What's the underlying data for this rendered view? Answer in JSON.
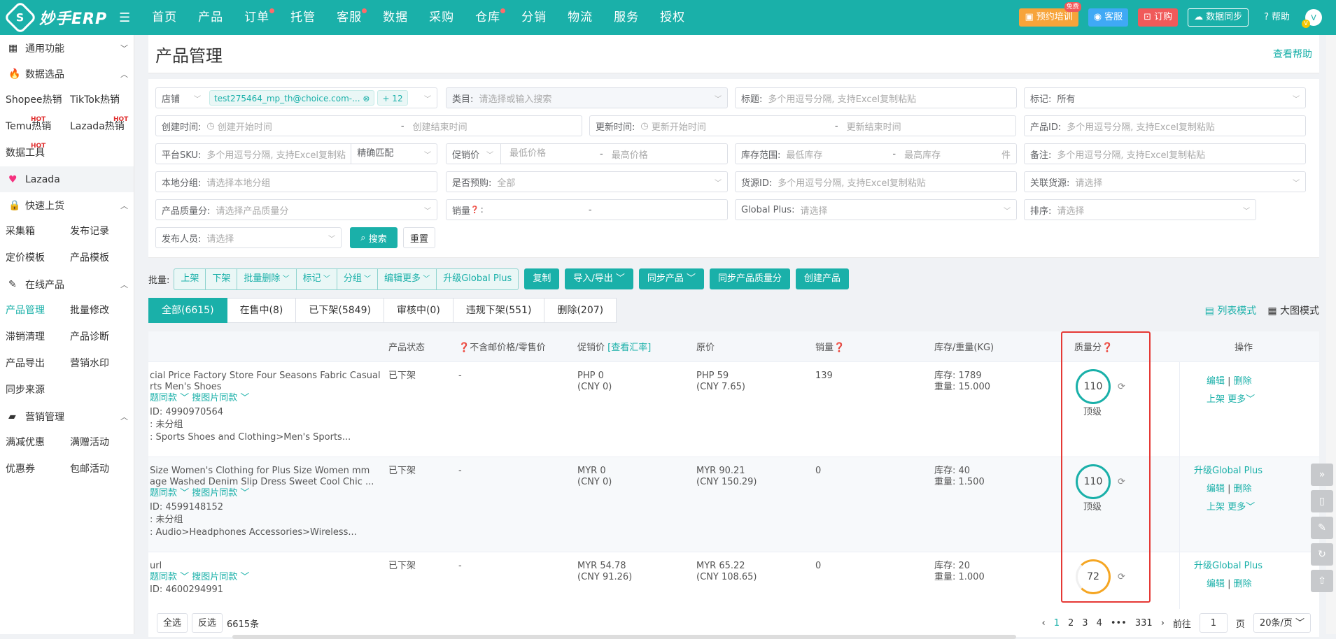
{
  "brand": {
    "logo_char": "S",
    "name": "妙手ERP"
  },
  "nav": [
    {
      "label": "首页",
      "dot": false
    },
    {
      "label": "产品",
      "dot": false
    },
    {
      "label": "订单",
      "dot": true
    },
    {
      "label": "托管",
      "dot": false
    },
    {
      "label": "客服",
      "dot": true
    },
    {
      "label": "数据",
      "dot": false
    },
    {
      "label": "采购",
      "dot": false
    },
    {
      "label": "仓库",
      "dot": true
    },
    {
      "label": "分销",
      "dot": false
    },
    {
      "label": "物流",
      "dot": false
    },
    {
      "label": "服务",
      "dot": false
    },
    {
      "label": "授权",
      "dot": false
    }
  ],
  "topright": {
    "training": "预约培训",
    "training_badge": "免费",
    "service": "客服",
    "order": "订购",
    "sync": "数据同步",
    "help": "帮助",
    "avatar": "V"
  },
  "sidebar": {
    "common": "通用功能",
    "data_select": "数据选品",
    "data_items": [
      "Shopee热销",
      "TikTok热销",
      "Temu热销",
      "Lazada热销",
      "数据工具"
    ],
    "hot": "HOT",
    "lazada": "Lazada",
    "quick_upload": "快速上货",
    "quick_items": [
      "采集箱",
      "发布记录",
      "定价模板",
      "产品模板"
    ],
    "online": "在线产品",
    "online_items": [
      "产品管理",
      "批量修改",
      "滞销清理",
      "产品诊断",
      "产品导出",
      "营销水印",
      "同步来源"
    ],
    "marketing": "营销管理",
    "marketing_items": [
      "满减优惠",
      "满赠活动",
      "优惠券",
      "包邮活动"
    ]
  },
  "page": {
    "title": "产品管理",
    "help": "查看帮助"
  },
  "filters": {
    "shop_label": "店铺",
    "shop_tag": "test275464_mp_th@choice.com-...",
    "shop_more": "+ 12",
    "category_label": "类目:",
    "category_ph": "请选择或输入搜索",
    "title_label": "标题:",
    "title_ph": "多个用逗号分隔, 支持Excel复制粘贴",
    "mark_label": "标记:",
    "mark_value": "所有",
    "created_label": "创建时间:",
    "created_start": "创建开始时间",
    "created_end": "创建结束时间",
    "updated_label": "更新时间:",
    "updated_start": "更新开始时间",
    "updated_end": "更新结束时间",
    "pid_label": "产品ID:",
    "pid_ph": "多个用逗号分隔, 支持Excel复制粘贴",
    "sku_label": "平台SKU:",
    "sku_ph": "多个用逗号分隔, 支持Excel复制粘",
    "sku_match": "精确匹配",
    "promo_label": "促销价",
    "price_min": "最低价格",
    "price_max": "最高价格",
    "stock_label": "库存范围:",
    "stock_min": "最低库存",
    "stock_max": "最高库存",
    "stock_unit": "件",
    "note_label": "备注:",
    "note_ph": "多个用逗号分隔, 支持Excel复制粘贴",
    "group_label": "本地分组:",
    "group_ph": "请选择本地分组",
    "preorder_label": "是否预购:",
    "preorder_value": "全部",
    "source_label": "货源ID:",
    "source_ph": "多个用逗号分隔, 支持Excel复制粘贴",
    "linked_label": "关联货源:",
    "linked_ph": "请选择",
    "quality_label": "产品质量分:",
    "quality_ph": "请选择产品质量分",
    "sales_label": "销量",
    "sales_sep": "-",
    "gplus_label": "Global Plus:",
    "gplus_ph": "请选择",
    "sort_label": "排序:",
    "sort_ph": "请选择",
    "publisher_label": "发布人员:",
    "publisher_ph": "请选择",
    "search": "搜索",
    "reset": "重置",
    "dash": "-"
  },
  "batch": {
    "label": "批量:",
    "group": [
      "上架",
      "下架",
      "批量删除",
      "标记",
      "分组",
      "编辑更多",
      "升级Global Plus"
    ],
    "buttons": [
      "复制",
      "导入/导出",
      "同步产品",
      "同步产品质量分",
      "创建产品"
    ]
  },
  "tabs": [
    "全部(6615)",
    "在售中(8)",
    "已下架(5849)",
    "审核中(0)",
    "违规下架(551)",
    "删除(207)"
  ],
  "view_modes": {
    "list": "列表模式",
    "grid": "大图模式"
  },
  "table": {
    "headers": {
      "status": "产品状态",
      "price": "不含邮价格/零售价",
      "promo": "促销价",
      "rate": "[查看汇率]",
      "orig": "原价",
      "sales": "销量",
      "stock": "库存/重量(KG)",
      "quality": "质量分",
      "ops": "操作"
    },
    "rows": [
      {
        "title1": "cial Price Factory Store Four Seasons Fabric Casual",
        "title2": "rts Men's Shoes",
        "same_title": "题同款",
        "same_img": "搜图片同款",
        "id": "ID: 4990970564",
        "group": ": 未分组",
        "cat": ": Sports Shoes and Clothing>Men's Sports...",
        "status": "已下架",
        "price": "-",
        "promo": "PHP 0",
        "promo_cny": "(CNY 0)",
        "promo_red": false,
        "orig": "PHP 59",
        "orig_cny": "(CNY 7.65)",
        "sales": "139",
        "stock": "库存: 1789",
        "weight": "重量: 15.000",
        "score": "110",
        "grade": "顶级",
        "full": true,
        "ops_gplus": "",
        "edit": "编辑",
        "del": "删除",
        "up": "上架",
        "more": "更多"
      },
      {
        "title1": " Size Women's Clothing for Plus Size Women mm",
        "title2": "age Washed Denim Slip Dress Sweet Cool Chic ...",
        "same_title": "题同款",
        "same_img": "搜图片同款",
        "id": "ID: 4599148152",
        "group": ": 未分组",
        "cat": ": Audio>Headphones Accessories>Wireless...",
        "status": "已下架",
        "price": "-",
        "promo": "MYR 0",
        "promo_cny": "(CNY 0)",
        "promo_red": false,
        "orig": "MYR 90.21",
        "orig_cny": "(CNY 150.29)",
        "sales": "0",
        "stock": "库存: 40",
        "weight": "重量: 1.500",
        "score": "110",
        "grade": "顶级",
        "full": true,
        "ops_gplus": "升级Global Plus",
        "edit": "编辑",
        "del": "删除",
        "up": "上架",
        "more": "更多"
      },
      {
        "title1": "url",
        "title2": "",
        "same_title": "题同款",
        "same_img": "搜图片同款",
        "id": "ID: 4600294991",
        "group": "",
        "cat": "",
        "status": "已下架",
        "price": "-",
        "promo": "MYR 54.78",
        "promo_cny": "(CNY 91.26)",
        "promo_red": true,
        "orig": "MYR 65.22",
        "orig_cny": "(CNY 108.65)",
        "sales": "0",
        "stock": "库存: 20",
        "weight": "重量: 1.000",
        "score": "72",
        "grade": "",
        "full": false,
        "ops_gplus": "升级Global Plus",
        "edit": "编辑",
        "del": "删除",
        "up": "",
        "more": ""
      }
    ]
  },
  "footer": {
    "select_all": "全选",
    "invert": "反选",
    "count": "6615条",
    "pages": [
      "1",
      "2",
      "3",
      "4",
      "331"
    ],
    "ellipsis": "•••",
    "goto": "前往",
    "goto_value": "1",
    "page_unit": "页",
    "per_page": "20条/页"
  }
}
